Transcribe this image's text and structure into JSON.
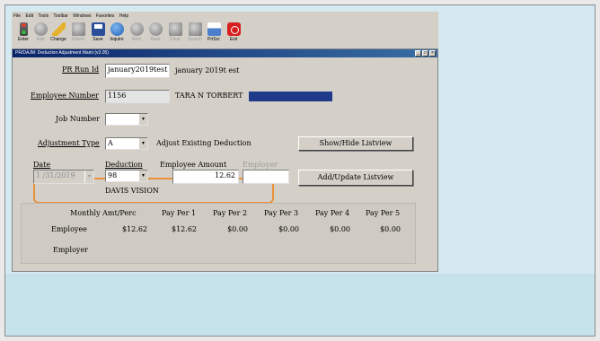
{
  "menu": [
    "File",
    "Edit",
    "Tools",
    "Toolbar",
    "Windows",
    "Favorites",
    "Help"
  ],
  "toolbar": [
    {
      "label": "Enter",
      "icon": "traffic-light-icon",
      "enabled": true
    },
    {
      "label": "Add",
      "icon": "add-icon",
      "enabled": false
    },
    {
      "label": "Change",
      "icon": "pencil-icon",
      "enabled": true
    },
    {
      "label": "Delete",
      "icon": "delete-icon",
      "enabled": false
    },
    {
      "label": "Save",
      "icon": "save-icon",
      "enabled": true
    },
    {
      "label": "Inquire",
      "icon": "info-icon",
      "enabled": true
    },
    {
      "label": "Next",
      "icon": "next-icon",
      "enabled": false
    },
    {
      "label": "Back",
      "icon": "back-icon",
      "enabled": false
    },
    {
      "label": "Clear",
      "icon": "clear-icon",
      "enabled": false
    },
    {
      "label": "Search",
      "icon": "binoculars-icon",
      "enabled": false
    },
    {
      "label": "PrtScr",
      "icon": "printer-icon",
      "enabled": true
    },
    {
      "label": "Exit",
      "icon": "exit-icon",
      "enabled": true
    }
  ],
  "window": {
    "title": "PR/DAJM: Deduction Adjustment Maint (v3.05)",
    "buttons": [
      "_",
      "□",
      "×"
    ]
  },
  "form": {
    "pr_run_id_label": "PR Run Id",
    "pr_run_id_value": "january2019test",
    "pr_run_id_desc": "january 2019t est",
    "employee_number_label": "Employee Number",
    "employee_number_value": "1156",
    "employee_name": "TARA N TORBERT",
    "job_number_label": "Job Number",
    "job_number_value": "",
    "adjustment_type_label": "Adjustment Type",
    "adjustment_type_value": "A",
    "adjustment_type_desc": "Adjust Existing Deduction",
    "show_hide_button": "Show/Hide Listview",
    "date_label": "Date",
    "date_value": "1 /31/2019",
    "deduction_label": "Deduction",
    "deduction_value": "98",
    "deduction_desc": "DAVIS VISION",
    "employee_amount_label": "Employee Amount",
    "employee_amount_value": "12.62",
    "employer_label": "Employer",
    "employer_value": "",
    "add_update_button": "Add/Update Listview"
  },
  "grid": {
    "columns": [
      "Monthly Amt/Perc",
      "Pay Per 1",
      "Pay Per 2",
      "Pay Per 3",
      "Pay Per 4",
      "Pay Per 5"
    ],
    "rows": [
      {
        "label": "Employee",
        "values": [
          "$12.62",
          "$12.62",
          "$0.00",
          "$0.00",
          "$0.00",
          "$0.00"
        ]
      },
      {
        "label": "Employer",
        "values": [
          "",
          "",
          "",
          "",
          "",
          ""
        ]
      }
    ]
  },
  "colors": {
    "highlight": "#e8913a",
    "name_bar": "#1f3a8a",
    "title_bar": "#0a246a"
  }
}
